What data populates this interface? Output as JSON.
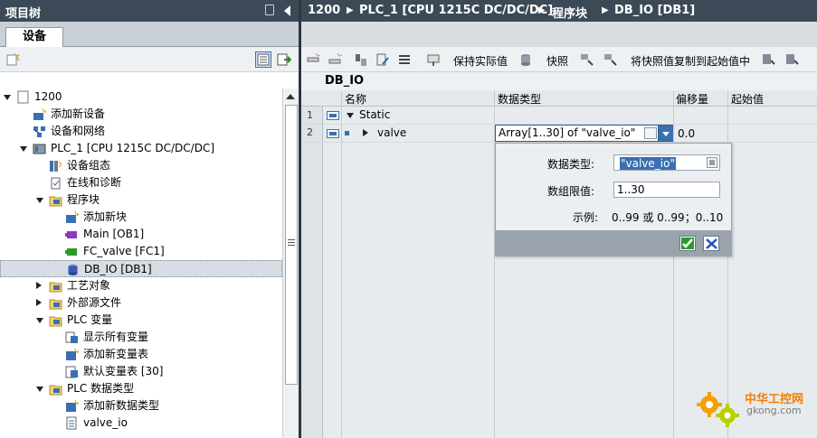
{
  "left_panel": {
    "title": "项目树",
    "tab_devices": "设备",
    "tree": [
      {
        "label": "1200",
        "icon": "project-icon",
        "state": "expanded"
      },
      {
        "label": "添加新设备",
        "icon": "add-device-icon",
        "state": "leaf"
      },
      {
        "label": "设备和网络",
        "icon": "network-icon",
        "state": "leaf"
      },
      {
        "label": "PLC_1 [CPU 1215C DC/DC/DC]",
        "icon": "plc-icon",
        "state": "expanded"
      },
      {
        "label": "设备组态",
        "icon": "device-config-icon",
        "state": "leaf"
      },
      {
        "label": "在线和诊断",
        "icon": "diagnostics-icon",
        "state": "leaf"
      },
      {
        "label": "程序块",
        "icon": "folder-icon",
        "state": "expanded"
      },
      {
        "label": "添加新块",
        "icon": "add-block-icon",
        "state": "leaf"
      },
      {
        "label": "Main [OB1]",
        "icon": "ob-icon",
        "state": "leaf"
      },
      {
        "label": "FC_valve [FC1]",
        "icon": "fc-icon",
        "state": "leaf"
      },
      {
        "label": "DB_IO [DB1]",
        "icon": "db-icon",
        "state": "selected"
      },
      {
        "label": "工艺对象",
        "icon": "folder-icon",
        "state": "collapsed"
      },
      {
        "label": "外部源文件",
        "icon": "folder-icon",
        "state": "collapsed"
      },
      {
        "label": "PLC 变量",
        "icon": "folder-icon",
        "state": "expanded"
      },
      {
        "label": "显示所有变量",
        "icon": "show-tags-icon",
        "state": "leaf"
      },
      {
        "label": "添加新变量表",
        "icon": "add-tagtable-icon",
        "state": "leaf"
      },
      {
        "label": "默认变量表 [30]",
        "icon": "tagtable-icon",
        "state": "leaf"
      },
      {
        "label": "PLC 数据类型",
        "icon": "folder-icon",
        "state": "expanded"
      },
      {
        "label": "添加新数据类型",
        "icon": "add-datatype-icon",
        "state": "leaf"
      },
      {
        "label": "valve_io",
        "icon": "udt-icon",
        "state": "leaf"
      }
    ]
  },
  "breadcrumb": [
    "1200",
    "PLC_1 [CPU 1215C DC/DC/DC]",
    "程序块",
    "DB_IO [DB1]"
  ],
  "toolbar": {
    "keep_actual": "保持实际值",
    "snapshot": "快照",
    "copy_snapshot": "将快照值复制到起始值中"
  },
  "editor": {
    "db_title": "DB_IO",
    "columns": [
      "名称",
      "数据类型",
      "偏移量",
      "起始值"
    ],
    "rows": [
      {
        "num": "1",
        "name": "Static"
      },
      {
        "num": "2",
        "name": "valve",
        "datatype": "Array[1..30] of \"valve_io\"",
        "offset": "0.0"
      }
    ]
  },
  "popup": {
    "datatype_label": "数据类型:",
    "datatype_value": "\"valve_io\"",
    "limits_label": "数组限值:",
    "limits_value": "1..30",
    "example_label": "示例:",
    "example_value": "0..99 或 0..99；0..10"
  },
  "watermark": {
    "title": "中华工控网",
    "url": "gkong.com"
  },
  "colors": {
    "title_bar": "#3c4a57",
    "selection": "#3a6fb0"
  }
}
